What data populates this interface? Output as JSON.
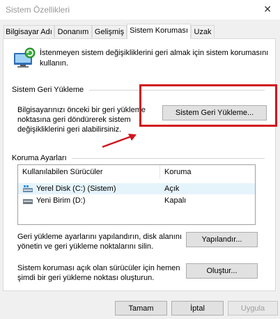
{
  "window": {
    "title": "Sistem Özellikleri",
    "close_glyph": "✕"
  },
  "tabs": [
    {
      "label": "Bilgisayar Adı"
    },
    {
      "label": "Donanım"
    },
    {
      "label": "Gelişmiş"
    },
    {
      "label": "Sistem Koruması"
    },
    {
      "label": "Uzak"
    }
  ],
  "active_tab": "Sistem Koruması",
  "intro": {
    "text": "İstenmeyen sistem değişikliklerini geri almak için sistem korumasını kullanın.",
    "icon": "system-protection-icon"
  },
  "restore": {
    "group_label": "Sistem Geri Yükleme",
    "description": "Bilgisayarınızı önceki bir geri yükleme noktasına geri döndürerek sistem değişikliklerini geri alabilirsiniz.",
    "button_label": "Sistem Geri Yükleme..."
  },
  "protection": {
    "group_label": "Koruma Ayarları",
    "columns": [
      "Kullanılabilen Sürücüler",
      "Koruma"
    ],
    "drives": [
      {
        "name": "Yerel Disk (C:) (Sistem)",
        "status": "Açık",
        "icon": "windows-drive-icon"
      },
      {
        "name": "Yeni Birim (D:)",
        "status": "Kapalı",
        "icon": "drive-icon"
      }
    ],
    "configure_text": "Geri yükleme ayarlarını yapılandırın, disk alanını yönetin ve geri yükleme noktalarını silin.",
    "configure_button": "Yapılandır...",
    "create_text": "Sistem koruması açık olan sürücüler için hemen şimdi bir geri yükleme noktası oluşturun.",
    "create_button": "Oluştur..."
  },
  "footer": {
    "ok": "Tamam",
    "cancel": "İptal",
    "apply": "Uygula"
  },
  "colors": {
    "highlight": "#d0141f",
    "selection": "#e5f3fb",
    "disabled_text": "#a0a0a0"
  }
}
